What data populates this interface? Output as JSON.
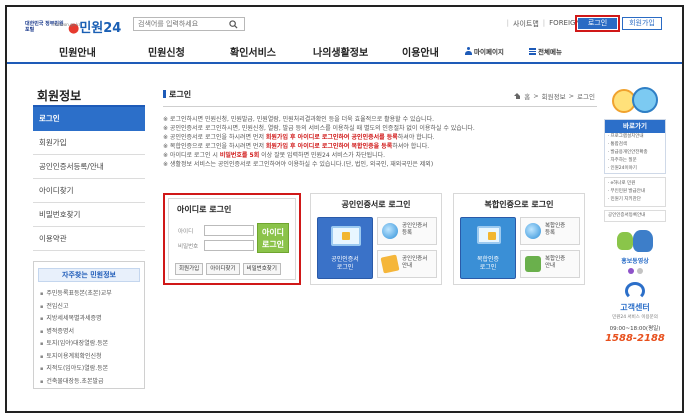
{
  "header": {
    "logo_gov": "대한민국 정부민원포털",
    "logo_main": "민원24",
    "logo_sub": "minwon.go.kr",
    "search_placeholder": "검색어를 입력하세요",
    "util_links": [
      "사이트맵",
      "FOREIGNER"
    ],
    "login_label": "로그인",
    "join_label": "회원가입"
  },
  "gnb": {
    "menus": [
      "민원안내",
      "민원신청",
      "확인서비스",
      "나의생활정보",
      "이용안내"
    ],
    "mypage": "마이페이지",
    "allmenu": "전체메뉴"
  },
  "lnb": {
    "title": "회원정보",
    "items": [
      "로그인",
      "회원가입",
      "공인인증서등록/안내",
      "아이디찾기",
      "비밀번호찾기",
      "이용약관"
    ],
    "active_index": 0
  },
  "frequent": {
    "title": "자주찾는 민원정보",
    "items": [
      "주민등록표등본(초본)교부",
      "전입신고",
      "지방세세목별과세증명",
      "병적증명서",
      "토지(임야)대장열람.등본",
      "토지이용계획확인신청",
      "지적도(임야도)열람.등본",
      "건축물대장등.초본발급"
    ]
  },
  "content": {
    "title": "로그인",
    "breadcrumb": [
      "홈",
      "회원정보",
      "로그인"
    ],
    "notices": [
      {
        "pre": "※ 로그인하시면 민원신청, 민원발급, 민원열람, 민원처리결과확인 등을 더욱 효율적으로 활용할 수 있습니다.",
        "hl": "",
        "post": ""
      },
      {
        "pre": "※ 공인인증서로 로그인하시면, 민원신청, 열람, 발급 등의 서비스를 이용하실 때 별도의 인증절차 없이 이용하실 수 있습니다.",
        "hl": "",
        "post": ""
      },
      {
        "pre": "※ 공인인증서로 로그인을 하시려면 먼저 ",
        "hl": "회원가입 후 아이디로 로그인하여 공인인증서를 등록",
        "post": "하셔야 합니다."
      },
      {
        "pre": "※ 복합인증으로 로그인을 하시려면 먼저 ",
        "hl": "회원가입 후 아이디로 로그인하여 복합인증을 등록",
        "post": "하셔야 합니다."
      },
      {
        "pre": "※ 아이디로 로그인 시 ",
        "hl": "비밀번호를 5회",
        "post": " 이상 잘못 입력하면 민원24 서비스가 차단됩니다."
      },
      {
        "pre": "※ 생활정보 서비스는 공인인증서로 로그인하여야 이용하실 수 있습니다.(단, 법인, 외국인, 재외국민은 제외)",
        "hl": "",
        "post": ""
      }
    ]
  },
  "id_login": {
    "title": "아이디로 로그인",
    "id_label": "아이디",
    "pw_label": "비밀번호",
    "submit": "아이디\n로그인",
    "links": [
      "회원가입",
      "아이디찾기",
      "비밀번호찾기"
    ]
  },
  "cert_login": {
    "title": "공인인증서로 로그인",
    "main": "공인인증서\n로그인",
    "opts": [
      "공인인증서\n등록",
      "공인인증서\n안내"
    ]
  },
  "multi_login": {
    "title": "복합인증으로 로그인",
    "main": "복합인증\n로그인",
    "opts": [
      "복합인증\n등록",
      "복합인증\n안내"
    ]
  },
  "side": {
    "quick_title": "바로가기",
    "quick_items": [
      "프로그램설치안내",
      "통합검색",
      "발급용개인안전확충",
      "자주하는 질문",
      "인원24이야기"
    ],
    "box2_items": [
      "e하나로 민원",
      "무인민원 발급안내",
      "민원기 지키찬단"
    ],
    "sep_item": "공인인증서등록안내",
    "promo": "홍보동영상",
    "cs_title": "고객센터",
    "cs_sub": "민원24 서비스 이용문의",
    "cs_hours": "09:00~18:00(평일)",
    "cs_phone": "1588-2188"
  }
}
